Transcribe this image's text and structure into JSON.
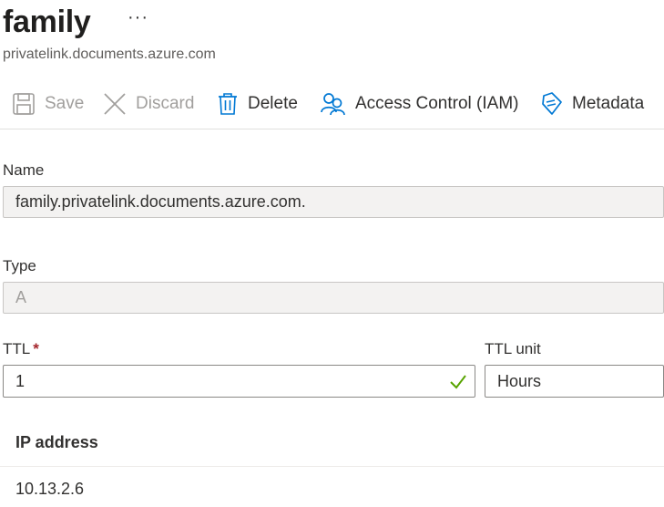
{
  "header": {
    "title": "family",
    "more_label": "···",
    "subtitle": "privatelink.documents.azure.com"
  },
  "toolbar": {
    "save_label": "Save",
    "discard_label": "Discard",
    "delete_label": "Delete",
    "iam_label": "Access Control (IAM)",
    "metadata_label": "Metadata"
  },
  "form": {
    "name_label": "Name",
    "name_value": "family.privatelink.documents.azure.com.",
    "type_label": "Type",
    "type_value": "A",
    "ttl_label": "TTL",
    "ttl_required_mark": "*",
    "ttl_value": "1",
    "ttl_unit_label": "TTL unit",
    "ttl_unit_value": "Hours"
  },
  "grid": {
    "column_header": "IP address",
    "rows": [
      "10.13.2.6"
    ]
  },
  "colors": {
    "accent": "#0078d4",
    "valid_check": "#57a300",
    "disabled_text": "#a19f9d",
    "required": "#a4262c"
  }
}
